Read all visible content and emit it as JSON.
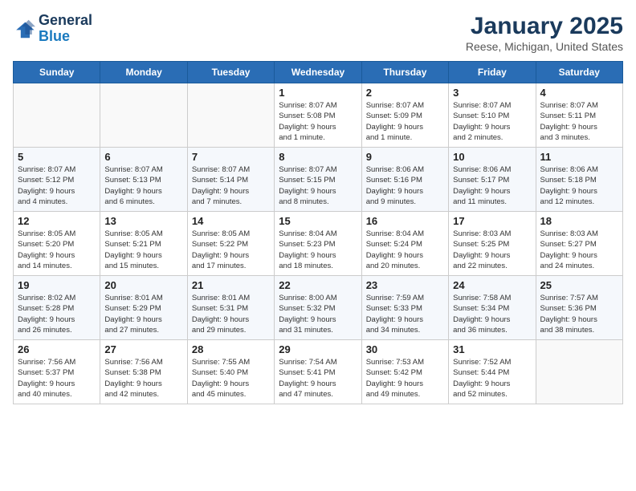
{
  "logo": {
    "line1": "General",
    "line2": "Blue"
  },
  "title": "January 2025",
  "subtitle": "Reese, Michigan, United States",
  "days_of_week": [
    "Sunday",
    "Monday",
    "Tuesday",
    "Wednesday",
    "Thursday",
    "Friday",
    "Saturday"
  ],
  "weeks": [
    [
      {
        "day": "",
        "content": ""
      },
      {
        "day": "",
        "content": ""
      },
      {
        "day": "",
        "content": ""
      },
      {
        "day": "1",
        "content": "Sunrise: 8:07 AM\nSunset: 5:08 PM\nDaylight: 9 hours\nand 1 minute."
      },
      {
        "day": "2",
        "content": "Sunrise: 8:07 AM\nSunset: 5:09 PM\nDaylight: 9 hours\nand 1 minute."
      },
      {
        "day": "3",
        "content": "Sunrise: 8:07 AM\nSunset: 5:10 PM\nDaylight: 9 hours\nand 2 minutes."
      },
      {
        "day": "4",
        "content": "Sunrise: 8:07 AM\nSunset: 5:11 PM\nDaylight: 9 hours\nand 3 minutes."
      }
    ],
    [
      {
        "day": "5",
        "content": "Sunrise: 8:07 AM\nSunset: 5:12 PM\nDaylight: 9 hours\nand 4 minutes."
      },
      {
        "day": "6",
        "content": "Sunrise: 8:07 AM\nSunset: 5:13 PM\nDaylight: 9 hours\nand 6 minutes."
      },
      {
        "day": "7",
        "content": "Sunrise: 8:07 AM\nSunset: 5:14 PM\nDaylight: 9 hours\nand 7 minutes."
      },
      {
        "day": "8",
        "content": "Sunrise: 8:07 AM\nSunset: 5:15 PM\nDaylight: 9 hours\nand 8 minutes."
      },
      {
        "day": "9",
        "content": "Sunrise: 8:06 AM\nSunset: 5:16 PM\nDaylight: 9 hours\nand 9 minutes."
      },
      {
        "day": "10",
        "content": "Sunrise: 8:06 AM\nSunset: 5:17 PM\nDaylight: 9 hours\nand 11 minutes."
      },
      {
        "day": "11",
        "content": "Sunrise: 8:06 AM\nSunset: 5:18 PM\nDaylight: 9 hours\nand 12 minutes."
      }
    ],
    [
      {
        "day": "12",
        "content": "Sunrise: 8:05 AM\nSunset: 5:20 PM\nDaylight: 9 hours\nand 14 minutes."
      },
      {
        "day": "13",
        "content": "Sunrise: 8:05 AM\nSunset: 5:21 PM\nDaylight: 9 hours\nand 15 minutes."
      },
      {
        "day": "14",
        "content": "Sunrise: 8:05 AM\nSunset: 5:22 PM\nDaylight: 9 hours\nand 17 minutes."
      },
      {
        "day": "15",
        "content": "Sunrise: 8:04 AM\nSunset: 5:23 PM\nDaylight: 9 hours\nand 18 minutes."
      },
      {
        "day": "16",
        "content": "Sunrise: 8:04 AM\nSunset: 5:24 PM\nDaylight: 9 hours\nand 20 minutes."
      },
      {
        "day": "17",
        "content": "Sunrise: 8:03 AM\nSunset: 5:25 PM\nDaylight: 9 hours\nand 22 minutes."
      },
      {
        "day": "18",
        "content": "Sunrise: 8:03 AM\nSunset: 5:27 PM\nDaylight: 9 hours\nand 24 minutes."
      }
    ],
    [
      {
        "day": "19",
        "content": "Sunrise: 8:02 AM\nSunset: 5:28 PM\nDaylight: 9 hours\nand 26 minutes."
      },
      {
        "day": "20",
        "content": "Sunrise: 8:01 AM\nSunset: 5:29 PM\nDaylight: 9 hours\nand 27 minutes."
      },
      {
        "day": "21",
        "content": "Sunrise: 8:01 AM\nSunset: 5:31 PM\nDaylight: 9 hours\nand 29 minutes."
      },
      {
        "day": "22",
        "content": "Sunrise: 8:00 AM\nSunset: 5:32 PM\nDaylight: 9 hours\nand 31 minutes."
      },
      {
        "day": "23",
        "content": "Sunrise: 7:59 AM\nSunset: 5:33 PM\nDaylight: 9 hours\nand 34 minutes."
      },
      {
        "day": "24",
        "content": "Sunrise: 7:58 AM\nSunset: 5:34 PM\nDaylight: 9 hours\nand 36 minutes."
      },
      {
        "day": "25",
        "content": "Sunrise: 7:57 AM\nSunset: 5:36 PM\nDaylight: 9 hours\nand 38 minutes."
      }
    ],
    [
      {
        "day": "26",
        "content": "Sunrise: 7:56 AM\nSunset: 5:37 PM\nDaylight: 9 hours\nand 40 minutes."
      },
      {
        "day": "27",
        "content": "Sunrise: 7:56 AM\nSunset: 5:38 PM\nDaylight: 9 hours\nand 42 minutes."
      },
      {
        "day": "28",
        "content": "Sunrise: 7:55 AM\nSunset: 5:40 PM\nDaylight: 9 hours\nand 45 minutes."
      },
      {
        "day": "29",
        "content": "Sunrise: 7:54 AM\nSunset: 5:41 PM\nDaylight: 9 hours\nand 47 minutes."
      },
      {
        "day": "30",
        "content": "Sunrise: 7:53 AM\nSunset: 5:42 PM\nDaylight: 9 hours\nand 49 minutes."
      },
      {
        "day": "31",
        "content": "Sunrise: 7:52 AM\nSunset: 5:44 PM\nDaylight: 9 hours\nand 52 minutes."
      },
      {
        "day": "",
        "content": ""
      }
    ]
  ]
}
